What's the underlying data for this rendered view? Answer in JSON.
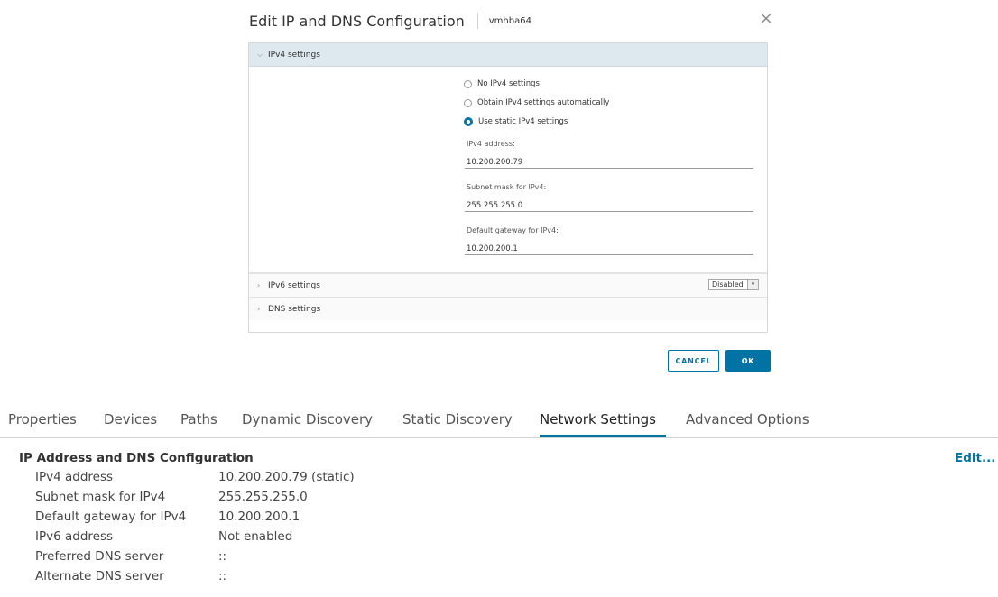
{
  "dialog": {
    "title": "Edit IP and DNS Configuration",
    "subtitle": "vmhba64",
    "close_icon": "×",
    "ipv4": {
      "header": "IPv4 settings",
      "options": [
        "No IPv4 settings",
        "Obtain IPv4 settings automatically",
        "Use static IPv4 settings"
      ],
      "selected_option": "Use static IPv4 settings",
      "address_label": "IPv4 address:",
      "address_value": "10.200.200.79",
      "subnet_label": "Subnet mask for IPv4:",
      "subnet_value": "255.255.255.0",
      "gateway_label": "Default gateway for IPv4:",
      "gateway_value": "10.200.200.1"
    },
    "ipv6": {
      "header": "IPv6 settings",
      "select_value": "Disabled"
    },
    "dns": {
      "header": "DNS settings"
    },
    "cancel_label": "CANCEL",
    "ok_label": "OK"
  },
  "page": {
    "tabs": [
      "Properties",
      "Devices",
      "Paths",
      "Dynamic Discovery",
      "Static Discovery",
      "Network Settings",
      "Advanced Options"
    ],
    "active_tab": "Network Settings",
    "section_title": "IP Address and DNS Configuration",
    "edit_label": "Edit...",
    "details": [
      {
        "key": "IPv4 address",
        "value": "10.200.200.79 (static)"
      },
      {
        "key": "Subnet mask for IPv4",
        "value": "255.255.255.0"
      },
      {
        "key": "Default gateway for IPv4",
        "value": "10.200.200.1"
      },
      {
        "key": "IPv6 address",
        "value": "Not enabled"
      },
      {
        "key": "Preferred DNS server",
        "value": "::"
      },
      {
        "key": "Alternate DNS server",
        "value": "::"
      }
    ]
  },
  "colors": {
    "accent": "#0072a3",
    "header_bg": "#dde8ef"
  }
}
